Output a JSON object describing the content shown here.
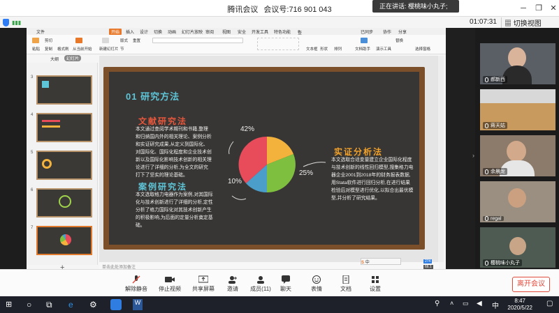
{
  "window": {
    "app_name": "腾讯会议",
    "meeting_id_label": "会议号:",
    "meeting_id": "716 901 043",
    "speaking_text": "正在讲话: 樱桃味小丸子;",
    "min_glyph": "─",
    "restore_glyph": "❐",
    "close_glyph": "✕"
  },
  "infobar": {
    "timer": "01:07:31",
    "layout_button": "切换视图"
  },
  "wps": {
    "menu": [
      "文件",
      "开始",
      "插入",
      "设计",
      "切换",
      "动画",
      "幻灯片放映",
      "审阅",
      "视图",
      "安全",
      "开发工具",
      "特色功能"
    ],
    "active_menu": "开始",
    "search": "查找",
    "right_menu": [
      "已同步",
      "协作",
      "分享"
    ],
    "ribbon_labels": [
      "粘贴",
      "剪切",
      "复制",
      "格式刷",
      "从当前开始",
      "新建幻灯片",
      "版式",
      "节",
      "重置",
      "文本框",
      "形状",
      "排列",
      "文档助手",
      "演示工具",
      "替换",
      "选择窗格"
    ],
    "panel_tabs": [
      "大纲",
      "幻灯片"
    ],
    "slide_numbers": [
      "3",
      "4",
      "5",
      "6",
      "7"
    ],
    "notes_placeholder": "单击此处添加备注",
    "add_slide": "+",
    "zoom_badge": "274",
    "zoom_value": "66.1"
  },
  "slide": {
    "heading": "01 研究方法",
    "sections": [
      {
        "title": "文献研究法",
        "body": "本文通过查阅学术期刊和书籍,整理和归纳国内外的相关理论、案例分析和实证研究成果,从定义到国际化、对国际化、国际化程度和企业技术创新以及国际化影响技术创新的相关理论进行了详细的分析,为全文的研究打下了坚实的理论基础。",
        "color": "#e8573c"
      },
      {
        "title": "案例研究法",
        "body": "本文选取格力电器作为案例,对其国际化与技术创新进行了详细的分析,定性分析了格力国际化对其技术创新产生的积极影响,为后面的定量分析奠定基础。",
        "color": "#5ec5d8"
      },
      {
        "title": "实证分析法",
        "body": "本文选取合适变量建立企业国际化程度与技术创新的线性回归模型,搜集格力电器企业2001到2018年的财务报表数据,用Stata软件进行回归分析,在进行结果检验后对模型进行优化,以拟合出最优模型,并分析了研究结果。",
        "color": "#f2a22a"
      }
    ],
    "pie_labels": [
      "42%",
      "25%",
      "10%"
    ],
    "pie_colors": [
      "#e84b5a",
      "#f2b23c",
      "#7fbf3f",
      "#4a9ec9"
    ]
  },
  "participants": [
    {
      "name": "郝新西",
      "mic": "on"
    },
    {
      "name": "蒋天姑",
      "mic": "on"
    },
    {
      "name": "余晨龙",
      "mic": "on"
    },
    {
      "name": "regal",
      "mic": "on"
    },
    {
      "name": "樱桃味小丸子",
      "mic": "on"
    }
  ],
  "toolbar": {
    "mute": "解除静音",
    "stop_video": "停止视频",
    "share": "共享屏幕",
    "invite": "邀请",
    "members": "成员(11)",
    "chat": "聊天",
    "emoji": "表情",
    "docs": "文档",
    "settings": "设置",
    "leave": "离开会议"
  },
  "taskbar": {
    "time": "8:47",
    "date": "2020/5/22",
    "ime": "中"
  },
  "colors": {
    "accent": "#e8792b",
    "board": "#383634",
    "frame": "#7a4f2a",
    "end_red": "#e04a3a"
  }
}
